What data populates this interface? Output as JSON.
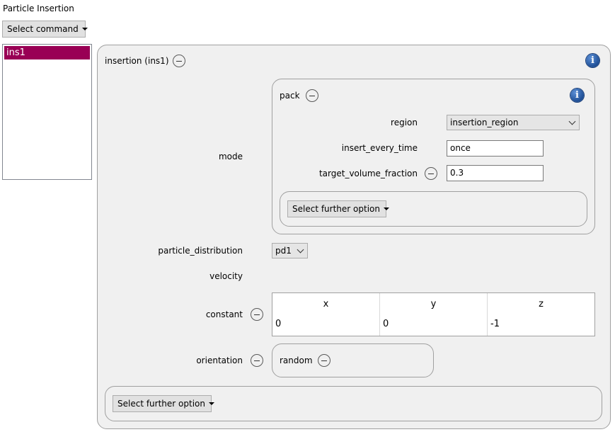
{
  "window": {
    "title": "Particle Insertion"
  },
  "toolbar": {
    "select_command": "Select command"
  },
  "list": {
    "items": [
      "ins1"
    ]
  },
  "insertion": {
    "header": "insertion (ins1)",
    "mode_label": "mode",
    "pack": {
      "header": "pack",
      "region_label": "region",
      "region_value": "insertion_region",
      "insert_every_time_label": "insert_every_time",
      "insert_every_time_value": "once",
      "target_volume_fraction_label": "target_volume_fraction",
      "target_volume_fraction_value": "0.3",
      "select_further_option": "Select further option"
    },
    "particle_distribution_label": "particle_distribution",
    "particle_distribution_value": "pd1",
    "velocity_label": "velocity",
    "constant_label": "constant",
    "constant_table": {
      "headers": [
        "x",
        "y",
        "z"
      ],
      "values": [
        "0",
        "0",
        "-1"
      ]
    },
    "orientation_label": "orientation",
    "orientation_value": "random",
    "select_further_option": "Select further option"
  },
  "colors": {
    "selection": "#990055",
    "panel_bg": "#f0f0f0",
    "info_icon": "#1f4f96"
  },
  "icons": {
    "remove": "minus-circle-icon",
    "info": "info-icon",
    "dropdown": "caret-down-icon"
  }
}
